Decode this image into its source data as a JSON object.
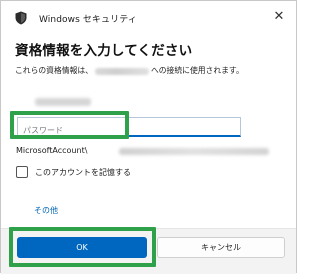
{
  "window": {
    "title": "Windows セキュリティ",
    "close_glyph": "✕"
  },
  "dialog": {
    "heading": "資格情報を入力してください",
    "description_prefix": "これらの資格情報は、",
    "description_suffix": "への接続に使用されます。"
  },
  "password": {
    "placeholder": "パスワード",
    "value": ""
  },
  "account": {
    "label": "MicrosoftAccount\\"
  },
  "remember": {
    "label": "このアカウントを記憶する",
    "checked": false
  },
  "links": {
    "more": "その他"
  },
  "buttons": {
    "ok": "OK",
    "cancel": "キャンセル"
  },
  "colors": {
    "accent": "#0067c0",
    "highlight": "#2fa14b",
    "link": "#0063b1"
  },
  "icons": {
    "title": "windows-security-shield-icon",
    "close": "close-icon"
  }
}
